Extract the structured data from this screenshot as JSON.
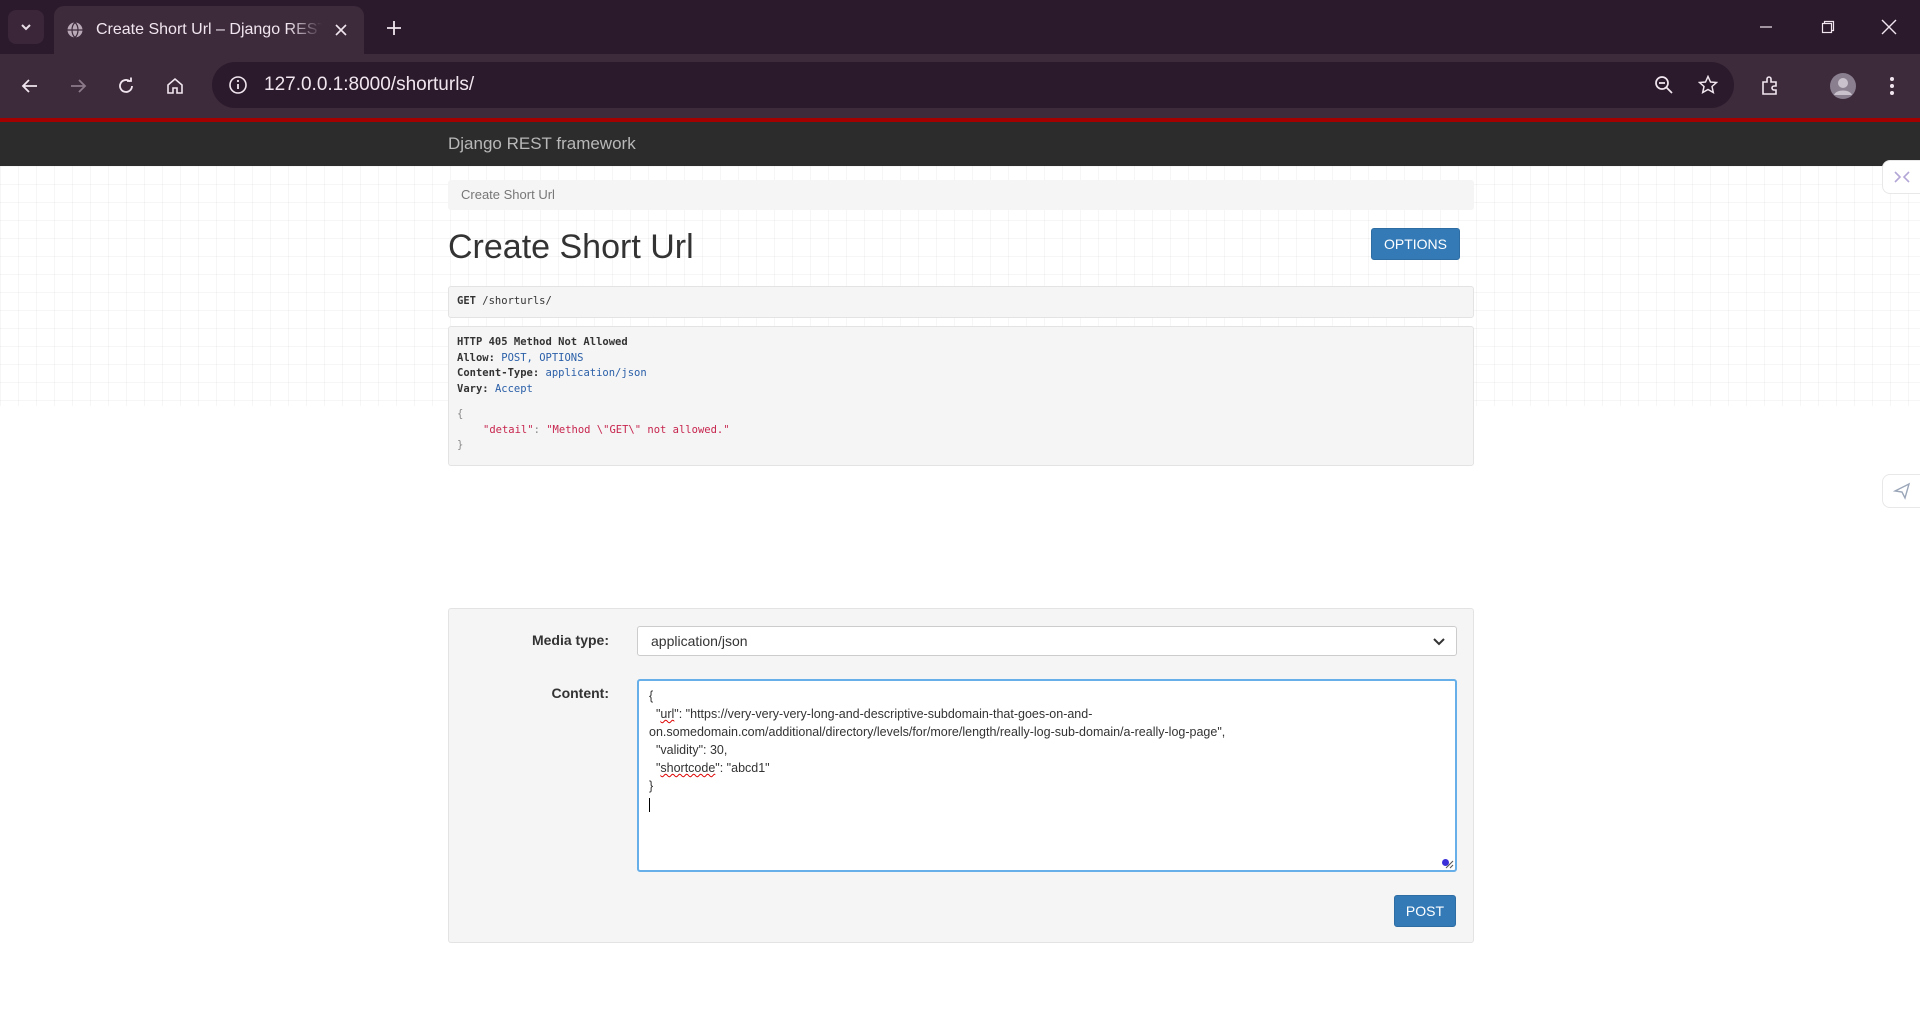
{
  "browser": {
    "tab_title": "Create Short Url – Django REST framework",
    "url": "127.0.0.1:8000/shorturls/"
  },
  "drf": {
    "brand": "Django REST framework",
    "breadcrumb": "Create Short Url",
    "title": "Create Short Url",
    "options_label": "OPTIONS",
    "request": {
      "method": "GET",
      "path": " /shorturls/"
    },
    "response": {
      "status": "HTTP 405 Method Not Allowed",
      "allow_key": "Allow:",
      "allow_val": "POST, OPTIONS",
      "ctype_key": "Content-Type:",
      "ctype_val": "application/json",
      "vary_key": "Vary:",
      "vary_val": "Accept",
      "open_brace": "{",
      "detail_key": "\"detail\"",
      "detail_val": "\"Method \\\"GET\\\" not allowed.\"",
      "close_brace": "}"
    },
    "form": {
      "media_type_label": "Media type:",
      "media_type_value": "application/json",
      "content_label": "Content:",
      "content_lines": {
        "l1": "{",
        "l2_key": "url",
        "l2_rest": "\": \"https://very-very-very-long-and-descriptive-subdomain-that-goes-on-and-",
        "l3": "on.somedomain.com/additional/directory/levels/for/more/length/really-log-sub-domain/a-really-log-page\",",
        "l4": "  \"validity\": 30,",
        "l5_key": "shortcode",
        "l5_rest": "\": \"abcd1\"",
        "l6": "}"
      },
      "post_label": "POST"
    }
  },
  "icons": {
    "tab_favicon": "globe-icon",
    "omnibox": [
      "info-icon",
      "zoom-icon",
      "bookmark-star-icon"
    ],
    "toolbar_right": [
      "extensions-icon",
      "profile-avatar",
      "menu-dots-icon"
    ]
  },
  "colors": {
    "tabbar": "#2b1a2b",
    "toolbar": "#3d2a3b",
    "drf_navbar": "#2c2c2c",
    "drf_accent": "#a40000",
    "primary_button": "#337ab7"
  }
}
